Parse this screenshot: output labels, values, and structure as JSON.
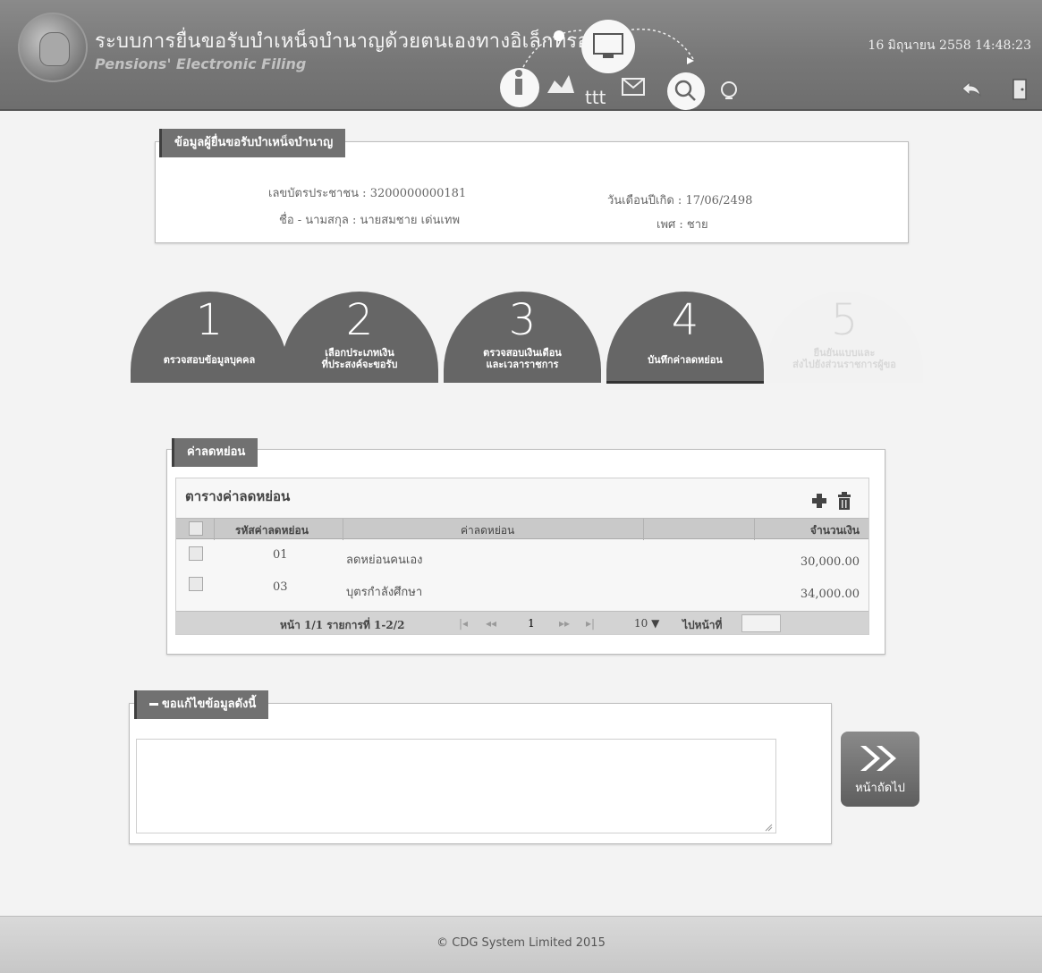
{
  "header": {
    "title_th": "ระบบการยื่นขอรับบำเหน็จบำนาญด้วยตนเองทางอิเล็กทรอนิกส์",
    "title_en": "Pensions' Electronic Filing",
    "datetime": "16 มิถุนายน 2558 14:48:23"
  },
  "applicant": {
    "legend": "ข้อมูลผู้ยื่นขอรับบำเหน็จบำนาญ",
    "id_label": "เลขบัตรประชาชน",
    "id_value": "3200000000181",
    "dob_label": "วันเดือนปีเกิด",
    "dob_value": "17/06/2498",
    "name_label": "ชื่อ - นามสกุล",
    "name_value": "นายสมชาย เด่นเทพ",
    "sex_label": "เพศ",
    "sex_value": "ชาย"
  },
  "steps": [
    {
      "num": "1",
      "label": "ตรวจสอบข้อมูลบุคคล"
    },
    {
      "num": "2",
      "label": "เลือกประเภทเงิน\nที่ประสงค์จะขอรับ"
    },
    {
      "num": "3",
      "label": "ตรวจสอบเงินเดือน\nและเวลาราชการ"
    },
    {
      "num": "4",
      "label": "บันทึกค่าลดหย่อน"
    },
    {
      "num": "5",
      "label": "ยืนยันแบบและ\nส่งไปยังส่วนราชการผู้ขอ"
    }
  ],
  "deduction": {
    "legend": "ค่าลดหย่อน",
    "table_title": "ตารางค่าลดหย่อน",
    "columns": [
      "รหัสค่าลดหย่อน",
      "ค่าลดหย่อน",
      "จำนวนเงิน"
    ],
    "rows": [
      {
        "code": "01",
        "name": "ลดหย่อนคนเอง",
        "amount": "30,000.00"
      },
      {
        "code": "03",
        "name": "บุตรกำลังศึกษา",
        "amount": "34,000.00"
      }
    ],
    "pager": {
      "summary": "หน้า 1/1 รายการที่ 1-2/2",
      "page": "1",
      "page_size": "10 ▼",
      "goto_label": "ไปหน้าที่"
    }
  },
  "edit_request": {
    "legend": "ขอแก้ไขข้อมูลดังนี้",
    "value": ""
  },
  "next_label": "หน้าถัดไป",
  "footer": "© CDG System Limited 2015"
}
